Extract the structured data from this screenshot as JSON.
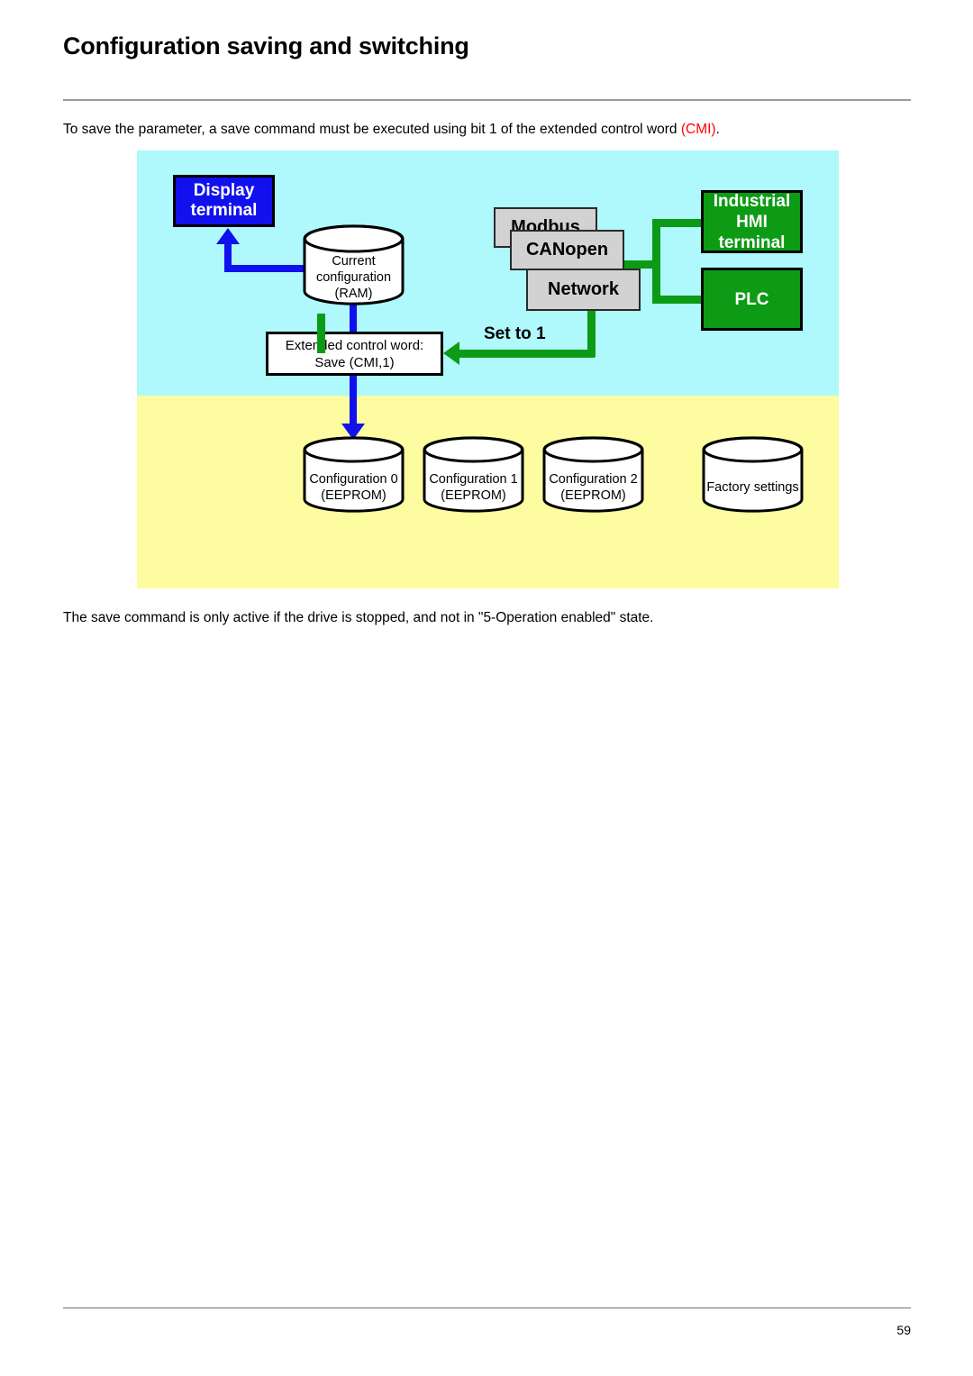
{
  "page": {
    "title": "Configuration saving and switching",
    "number": "59",
    "intro_text_before": "To save the parameter, a save command must be executed using bit 1 of the extended control word ",
    "intro_text_accent": "(CMI)",
    "intro_text_after": ".",
    "outro_text": "The save command is only active if the drive is stopped, and not in \"5-Operation enabled\" state."
  },
  "diagram": {
    "bands": {
      "volatile_color": "#aff8fb",
      "persistent_color": "#fdfca1"
    },
    "colors": {
      "blue": "#1111ee",
      "green": "#0d9b16",
      "grey": "#d2d2d2",
      "red": "#ff0000"
    },
    "display_terminal": {
      "line1": "Display",
      "line2": "terminal"
    },
    "ram": {
      "line1": "Current",
      "line2": "configuration",
      "line3": "(RAM)"
    },
    "control_word": {
      "line1": "Extended control word:",
      "line2": "Save (CMI,1)"
    },
    "protocol_stack": [
      {
        "label": "Modbus"
      },
      {
        "label": "CANopen"
      },
      {
        "label": "Network"
      }
    ],
    "masters": [
      {
        "line1": "Industrial",
        "line2": "HMI",
        "line3": "terminal"
      },
      {
        "line1": "PLC",
        "line2": "",
        "line3": ""
      }
    ],
    "set_to_label": "Set to 1",
    "eeprom_stores": [
      {
        "line1": "Configuration 0",
        "line2": "(EEPROM)"
      },
      {
        "line1": "Configuration 1",
        "line2": "(EEPROM)"
      },
      {
        "line1": "Configuration 2",
        "line2": "(EEPROM)"
      },
      {
        "line1": "Factory settings",
        "line2": ""
      }
    ]
  }
}
